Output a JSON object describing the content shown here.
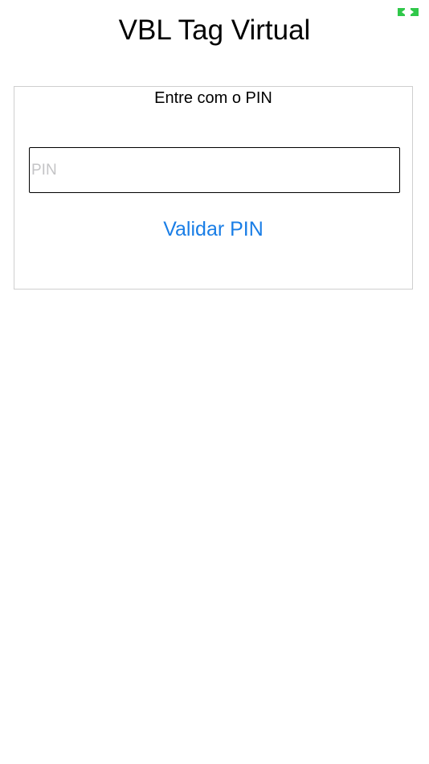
{
  "header": {
    "title": "VBL Tag Virtual",
    "status_icon": "battery-icon",
    "status_icon_color": "#30c84a"
  },
  "pin_panel": {
    "label": "Entre com o PIN",
    "input": {
      "value": "",
      "placeholder": "PIN"
    },
    "validate_button_label": "Validar PIN"
  },
  "colors": {
    "accent": "#1a7ee6",
    "placeholder": "#c4c4c6",
    "panel_border": "#cfcfcf"
  }
}
